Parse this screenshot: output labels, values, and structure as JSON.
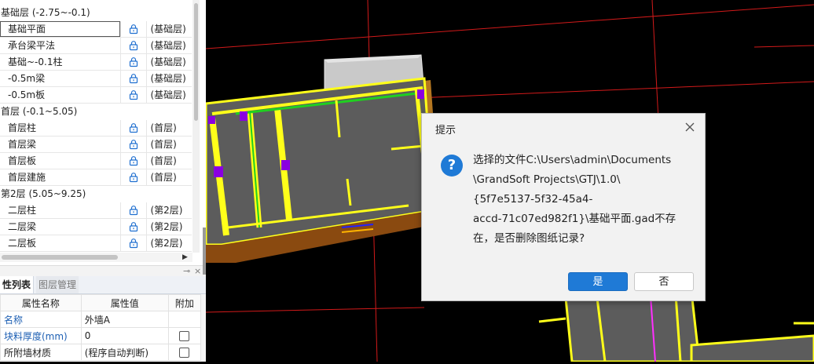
{
  "layers": {
    "groups": [
      {
        "title": "基础层 (-2.75~-0.1)",
        "items": [
          {
            "name": "基础平面",
            "tag": "(基础层)",
            "selected": true
          },
          {
            "name": "承台梁平法",
            "tag": "(基础层)"
          },
          {
            "name": "基础~-0.1柱",
            "tag": "(基础层)"
          },
          {
            "name": "-0.5m梁",
            "tag": "(基础层)"
          },
          {
            "name": "-0.5m板",
            "tag": "(基础层)"
          }
        ]
      },
      {
        "title": "首层 (-0.1~5.05)",
        "items": [
          {
            "name": "首层柱",
            "tag": "(首层)"
          },
          {
            "name": "首层梁",
            "tag": "(首层)"
          },
          {
            "name": "首层板",
            "tag": "(首层)"
          },
          {
            "name": "首层建施",
            "tag": "(首层)"
          }
        ]
      },
      {
        "title": "第2层 (5.05~9.25)",
        "items": [
          {
            "name": "二层柱",
            "tag": "(第2层)"
          },
          {
            "name": "二层梁",
            "tag": "(第2层)"
          },
          {
            "name": "二层板",
            "tag": "(第2层)"
          }
        ]
      }
    ]
  },
  "panel": {
    "pin_glyph": "⊸",
    "close_glyph": "×"
  },
  "properties": {
    "tabs": [
      "性列表",
      "图层管理"
    ],
    "headers": [
      "属性名称",
      "属性值",
      "附加"
    ],
    "rows": [
      {
        "key": "名称",
        "value": "外墙A",
        "has_check": false
      },
      {
        "key": "块料厚度(mm)",
        "value": "0",
        "has_check": true
      },
      {
        "key": "所附墙材质",
        "value": "(程序自动判断)",
        "has_check": true
      }
    ]
  },
  "dialog": {
    "title": "提示",
    "icon": "question-icon",
    "message_lines": [
      "选择的文件C:\\Users\\admin\\Documents",
      "\\GrandSoft Projects\\GTJ\\1.0\\",
      "{5f7e5137-5f32-45a4-",
      "accd-71c07ed982f1}\\基础平面.gad不存",
      "在，是否删除图纸记录?"
    ],
    "yes_label": "是",
    "no_label": "否"
  },
  "colors": {
    "accent": "#1f7ad6",
    "canvas": "#000000",
    "red_line": "#d21a1a",
    "beam_yellow": "#ffff1a"
  }
}
